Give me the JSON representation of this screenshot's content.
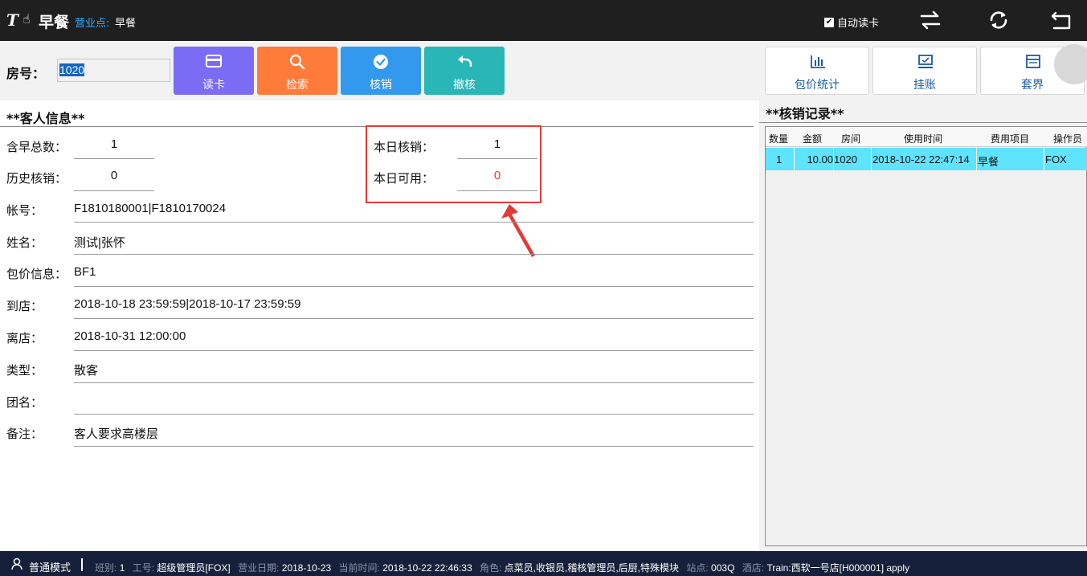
{
  "header": {
    "app_title": "早餐",
    "outlet_label": "营业点:",
    "outlet_value": "早餐",
    "auto_read_label": "自动读卡",
    "auto_read_checked": true
  },
  "toolbar": {
    "room_label": "房号：",
    "room_value": "1020",
    "buttons": [
      {
        "label": "读卡",
        "color": "#7b6cf5",
        "icon": "card-icon"
      },
      {
        "label": "检索",
        "color": "#ff7b3a",
        "icon": "search-icon"
      },
      {
        "label": "核销",
        "color": "#3399ee",
        "icon": "check-circle-icon"
      },
      {
        "label": "撤核",
        "color": "#2ab6b6",
        "icon": "undo-icon"
      }
    ],
    "right_buttons": [
      {
        "label": "包价统计",
        "icon": "bar-chart-icon"
      },
      {
        "label": "挂账",
        "icon": "monitor-icon"
      },
      {
        "label": "套界",
        "icon": "window-icon"
      }
    ]
  },
  "guest": {
    "title": "**客人信息**",
    "breakfast_total_label": "含早总数：",
    "breakfast_total": "1",
    "history_label": "历史核销：",
    "history": "0",
    "today_used_label": "本日核销：",
    "today_used": "1",
    "today_avail_label": "本日可用：",
    "today_avail": "0",
    "account_label": "帐号：",
    "account": "F1810180001|F1810170024",
    "name_label": "姓名：",
    "name": "测试|张怀",
    "package_label": "包价信息：",
    "package": "BF1",
    "arrival_label": "到店：",
    "arrival": "2018-10-18 23:59:59|2018-10-17 23:59:59",
    "departure_label": "离店：",
    "departure": "2018-10-31 12:00:00",
    "type_label": "类型：",
    "type": "散客",
    "group_label": "团名：",
    "group": "",
    "remark_label": "备注：",
    "remark": "客人要求高楼层"
  },
  "records": {
    "title": "**核销记录**",
    "columns": [
      "数量",
      "金额",
      "房间",
      "使用时间",
      "费用项目",
      "操作员"
    ],
    "rows": [
      {
        "qty": "1",
        "amount": "10.00",
        "room": "1020",
        "time": "2018-10-22 22:47:14",
        "item": "早餐",
        "operator": "FOX"
      }
    ]
  },
  "status": {
    "mode": "普通模式",
    "shift_k": "班别:",
    "shift_v": "1",
    "emp_k": "工号:",
    "emp_v": "超级管理员[FOX]",
    "bizdate_k": "营业日期:",
    "bizdate_v": "2018-10-23",
    "now_k": "当前时间:",
    "now_v": "2018-10-22 22:46:33",
    "role_k": "角色:",
    "role_v": "点菜员,收银员,稽核管理员,后厨,特殊模块",
    "station_k": "站点:",
    "station_v": "003Q",
    "hotel_k": "酒店:",
    "hotel_v": "Train:西软一号店[H000001] apply"
  },
  "colors": {
    "highlight_row": "#5ee4ff",
    "callout": "#e53935",
    "accent_blue": "#39a8ff"
  }
}
